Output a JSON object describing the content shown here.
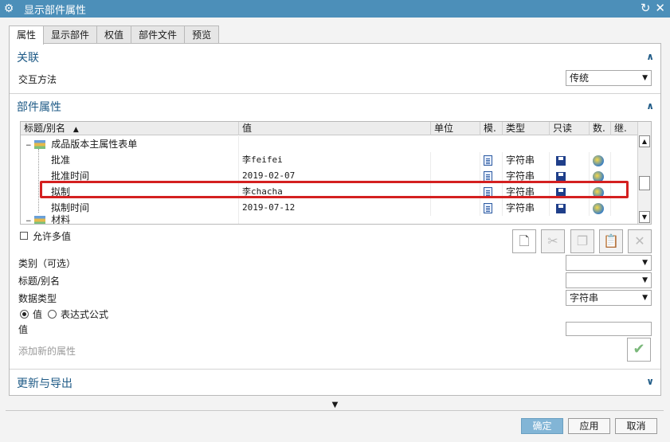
{
  "window": {
    "title": "显示部件属性"
  },
  "tabs": [
    {
      "label": "属性",
      "active": true
    },
    {
      "label": "显示部件",
      "active": false
    },
    {
      "label": "权值",
      "active": false
    },
    {
      "label": "部件文件",
      "active": false
    },
    {
      "label": "预览",
      "active": false
    }
  ],
  "association": {
    "title": "关联",
    "method_label": "交互方法",
    "method_value": "传统"
  },
  "part_attributes": {
    "title": "部件属性",
    "columns": [
      "标题/别名",
      "值",
      "单位",
      "模.",
      "类型",
      "只读",
      "数.",
      "继."
    ],
    "group_label": "成品版本主属性表单",
    "rows": [
      {
        "title": "批准",
        "value": "李feifei",
        "type": "字符串"
      },
      {
        "title": "批准时间",
        "value": "2019-02-07",
        "type": "字符串"
      },
      {
        "title": "拟制",
        "value": "李chacha",
        "type": "字符串"
      },
      {
        "title": "拟制时间",
        "value": "2019-07-12",
        "type": "字符串"
      }
    ],
    "next_group_label": "材料",
    "allow_multiple_label": "允许多值",
    "category_label": "类别（可选）",
    "title_alias_label": "标题/别名",
    "datatype_label": "数据类型",
    "datatype_value": "字符串",
    "radio_value_label": "值",
    "radio_expression_label": "表达式公式",
    "value_label": "值",
    "add_new_label": "添加新的属性"
  },
  "update_export": {
    "title": "更新与导出"
  },
  "buttons": {
    "ok": "确定",
    "apply": "应用",
    "cancel": "取消"
  },
  "colors": {
    "titlebar": "#4c8fb9",
    "accent": "#1e5a86",
    "highlight": "#d42020",
    "primary_button": "#82b5d6"
  }
}
